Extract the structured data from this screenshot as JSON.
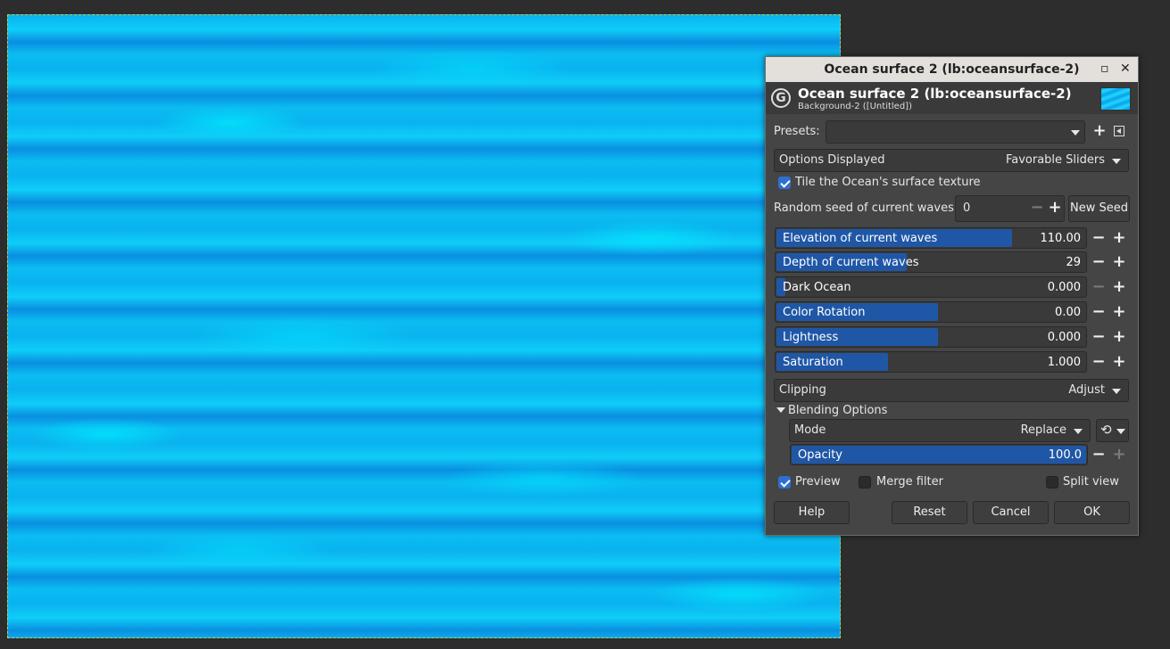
{
  "canvas": {
    "name": "ocean-surface-texture"
  },
  "dialog": {
    "window_title": "Ocean surface 2 (lb:oceansurface-2)",
    "header_title": "Ocean surface 2 (lb:oceansurface-2)",
    "header_subtitle": "Background-2 ([Untitled])",
    "presets_label": "Presets:",
    "presets_value": "",
    "options_displayed_label": "Options Displayed",
    "options_displayed_value": "Favorable Sliders",
    "tile_label": "Tile the Ocean's surface texture",
    "tile_checked": true,
    "seed_label": "Random seed of current waves",
    "seed_value": "0",
    "new_seed_label": "New Seed",
    "sliders": [
      {
        "label": "Elevation of current waves",
        "value": "110.00",
        "fraction": 0.76
      },
      {
        "label": "Depth of current waves",
        "value": "29",
        "fraction": 0.42
      },
      {
        "label": "Dark Ocean",
        "value": "0.000",
        "fraction": 0.03
      },
      {
        "label": "Color Rotation",
        "value": "0.00",
        "fraction": 0.52
      },
      {
        "label": "Lightness",
        "value": "0.000",
        "fraction": 0.52
      },
      {
        "label": "Saturation",
        "value": "1.000",
        "fraction": 0.36
      }
    ],
    "clipping_label": "Clipping",
    "clipping_value": "Adjust",
    "blending_label": "Blending Options",
    "mode_label": "Mode",
    "mode_value": "Replace",
    "opacity_label": "Opacity",
    "opacity_value": "100.0",
    "opacity_fraction": 1.0,
    "preview_label": "Preview",
    "preview_checked": true,
    "merge_label": "Merge filter",
    "merge_checked": false,
    "split_label": "Split view",
    "split_checked": false,
    "help_label": "Help",
    "reset_label": "Reset",
    "cancel_label": "Cancel",
    "ok_label": "OK"
  },
  "colors": {
    "accent": "#1f57a6",
    "check": "#2f6fd0",
    "background": "#2d2d2d",
    "panel": "#454545"
  }
}
